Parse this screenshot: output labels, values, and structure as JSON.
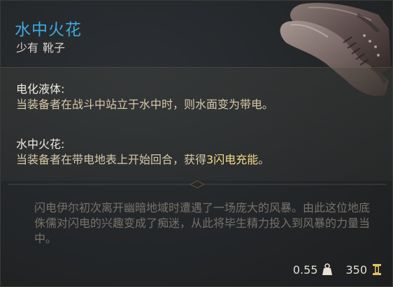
{
  "item": {
    "name": "水中火花",
    "rarity": "少有",
    "type": "靴子"
  },
  "passives": [
    {
      "title": "电化液体:",
      "description": "当装备者在战斗中站立于水中时，则水面变为带电。"
    },
    {
      "title": "水中火花:",
      "description_prefix": "当装备者在带电地表上开始回合，获得",
      "description_highlight": "3闪电充能",
      "description_suffix": "。"
    }
  ],
  "lore": "闪电伊尔初次离开幽暗地域时遭遇了一场庞大的风暴。由此这位地底侏儒对闪电的兴趣变成了痴迷，从此将毕生精力投入到风暴的力量当中。",
  "footer": {
    "weight": "0.55",
    "weight_icon": "weight-icon",
    "value": "350",
    "value_icon": "gold-icon"
  },
  "colors": {
    "name": "#3fa9e0",
    "highlight": "#f5dd8a",
    "lore": "#77726a"
  }
}
